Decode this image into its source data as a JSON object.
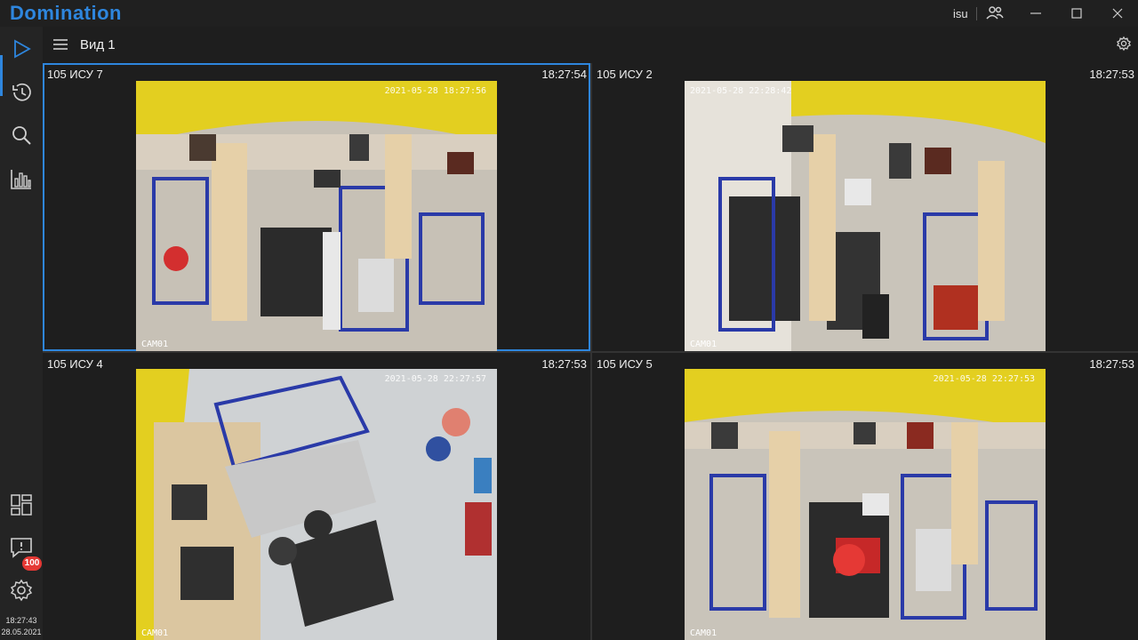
{
  "app": {
    "title": "Domination",
    "user": "isu"
  },
  "toolbar": {
    "view_title": "Вид 1"
  },
  "sidebar": {
    "items": [
      {
        "name": "live-view",
        "icon": "play-icon",
        "active": true
      },
      {
        "name": "archive",
        "icon": "history-icon"
      },
      {
        "name": "search",
        "icon": "search-icon"
      },
      {
        "name": "statistics",
        "icon": "bar-chart-icon"
      }
    ],
    "bottom_items": [
      {
        "name": "layouts",
        "icon": "layout-icon"
      },
      {
        "name": "events",
        "icon": "message-alert-icon",
        "badge": "100"
      },
      {
        "name": "settings",
        "icon": "gear-icon"
      }
    ],
    "clock_time": "18:27:43",
    "clock_date": "28.05.2021"
  },
  "cameras": [
    {
      "name": "105 ИСУ 7",
      "time": "18:27:54",
      "osd": "2021-05-28 18:27:56",
      "label": "CAM01",
      "selected": true
    },
    {
      "name": "105 ИСУ 2",
      "time": "18:27:53",
      "osd": "2021-05-28 22:28:42",
      "label": "CAM01",
      "selected": false
    },
    {
      "name": "105 ИСУ 4",
      "time": "18:27:53",
      "osd": "2021-05-28 22:27:57",
      "label": "CAM01",
      "selected": false
    },
    {
      "name": "105 ИСУ 5",
      "time": "18:27:53",
      "osd": "2021-05-28 22:27:53",
      "label": "CAM01",
      "selected": false
    }
  ],
  "colors": {
    "accent": "#2e86de",
    "badge": "#e53935",
    "wall_yellow": "#e8d41e",
    "shelf_blue": "#2a3aa8"
  }
}
